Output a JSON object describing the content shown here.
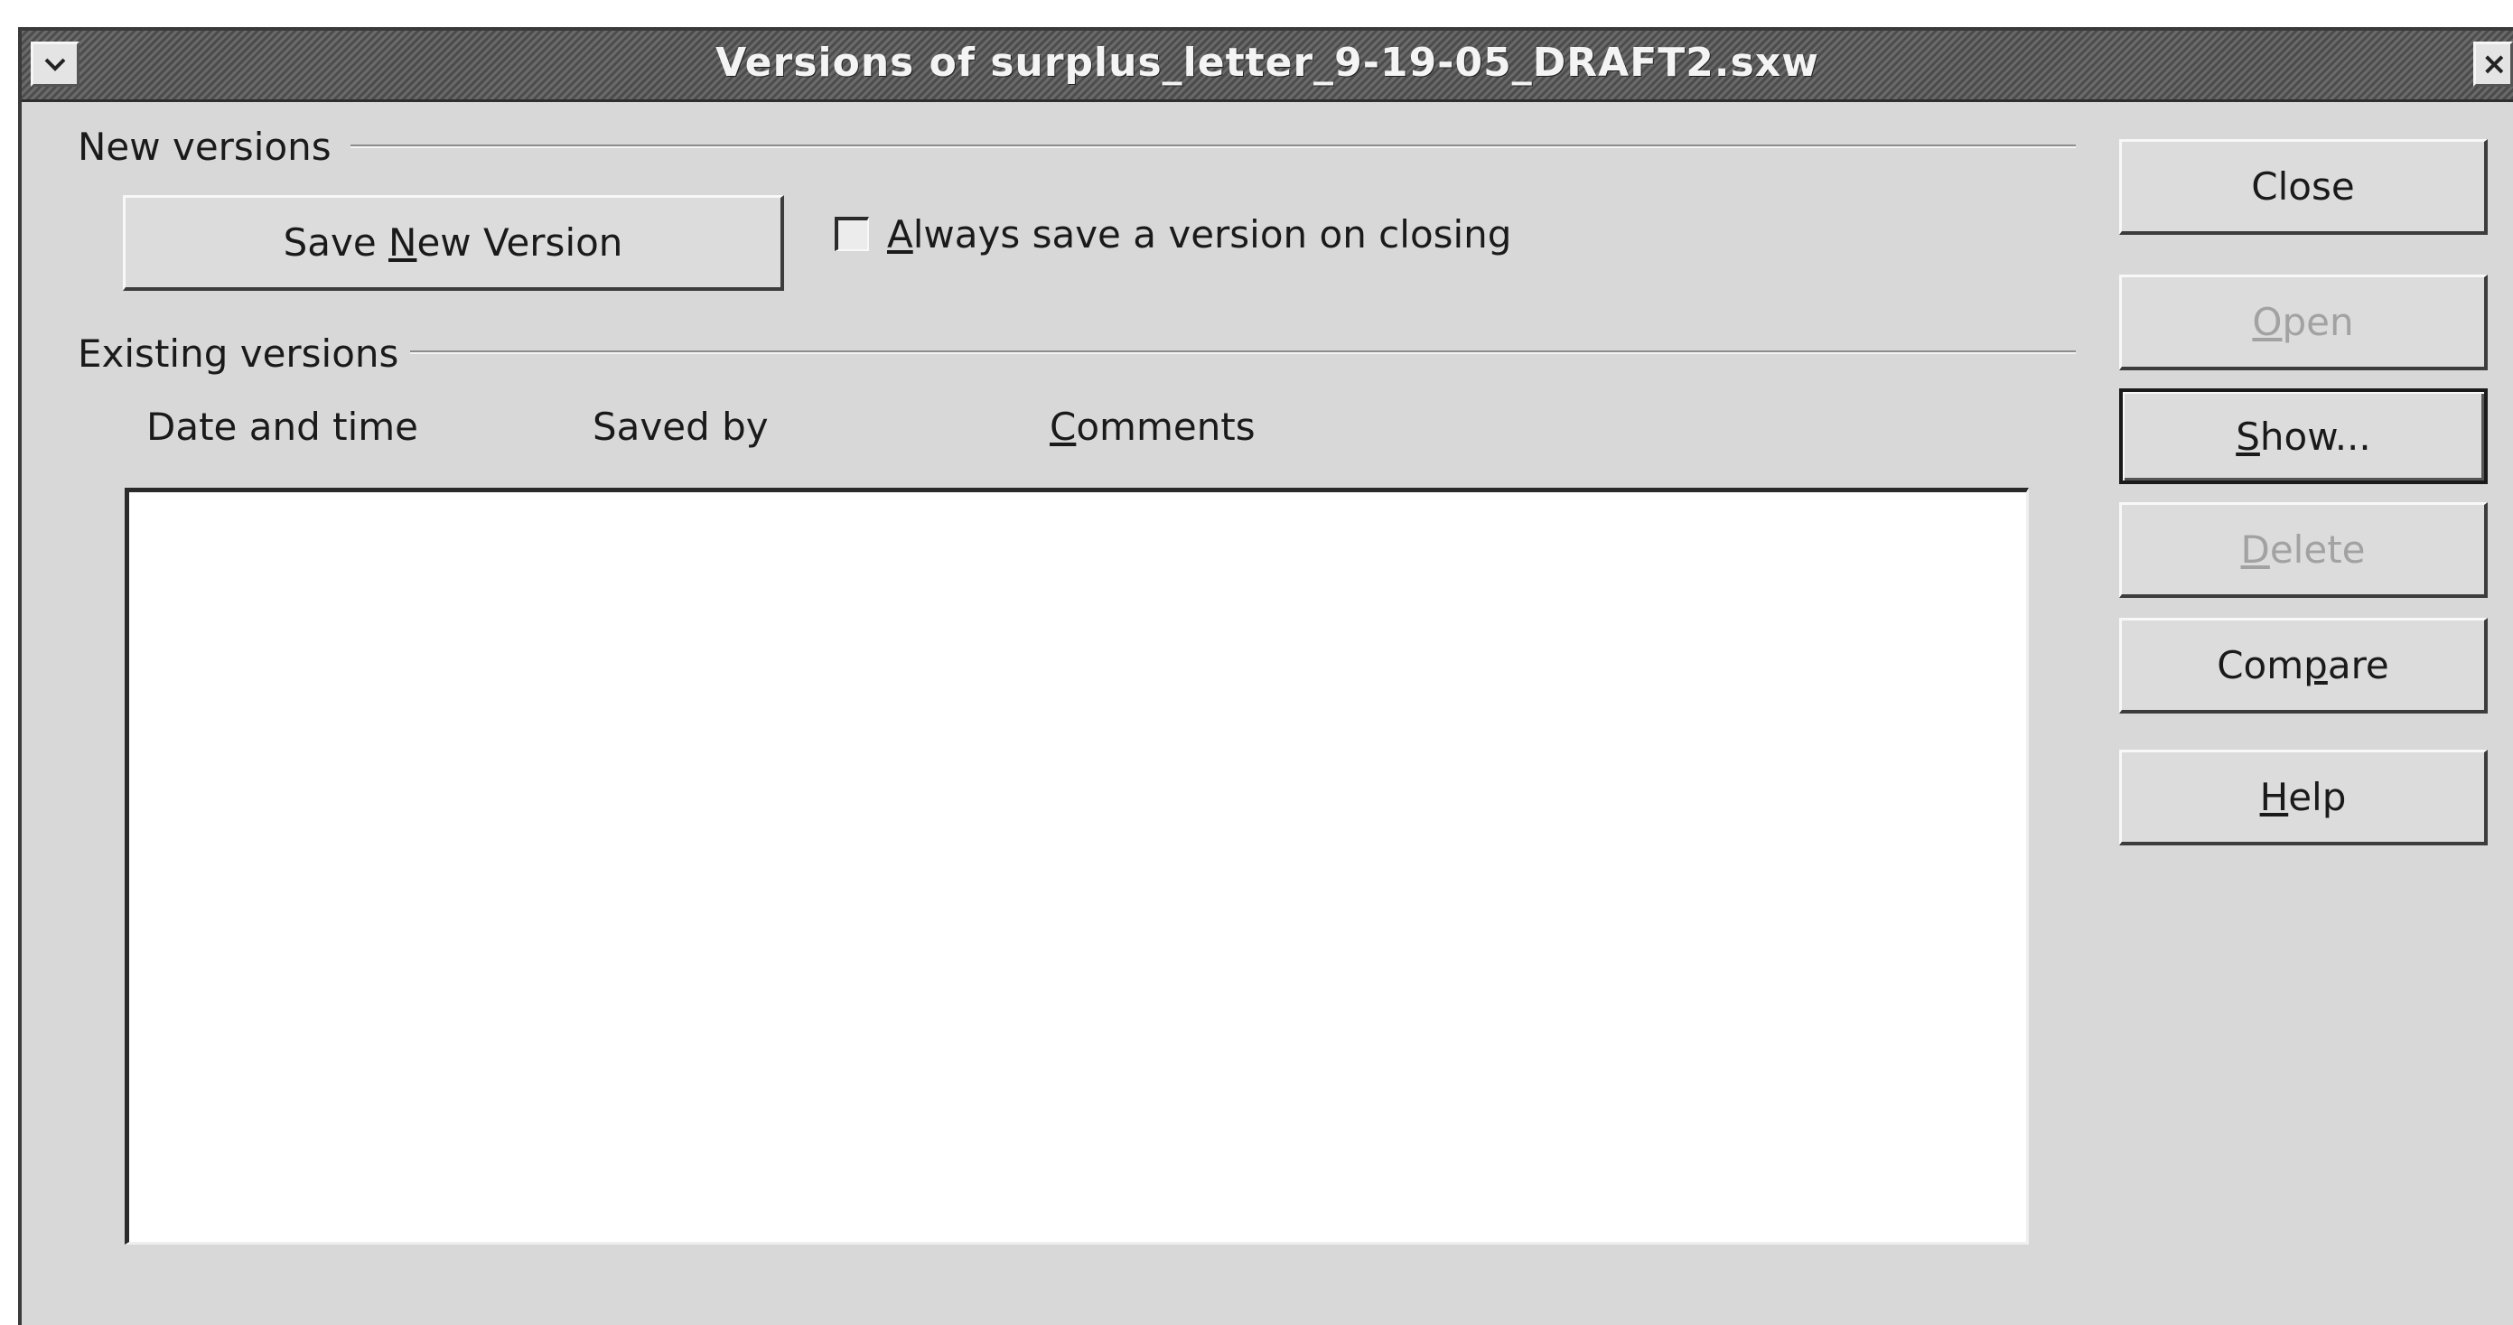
{
  "window": {
    "title": "Versions of surplus_letter_9-19-05_DRAFT2.sxw",
    "menu_icon": "chevron-down-icon",
    "close_icon": "close-icon",
    "close_glyph": "×"
  },
  "new_versions": {
    "group_label": "New versions",
    "save_button": {
      "prefix": "Save ",
      "mnemonic": "N",
      "suffix": "ew Version"
    },
    "always_save": {
      "checked": false,
      "mnemonic": "A",
      "rest": "lways save a version on closing"
    }
  },
  "existing_versions": {
    "group_label": "Existing versions",
    "columns": {
      "date": "Date and time",
      "saved_by": "Saved by",
      "comments_mnemonic": "C",
      "comments_rest": "omments"
    },
    "rows": []
  },
  "buttons": {
    "close": {
      "label": "Close"
    },
    "open": {
      "mnemonic": "O",
      "rest": "pen",
      "disabled": true
    },
    "show": {
      "mnemonic": "S",
      "rest": "how...",
      "default": true
    },
    "delete": {
      "mnemonic": "D",
      "rest": "elete",
      "disabled": true
    },
    "compare": {
      "prefix": "Com",
      "mnemonic": "p",
      "rest": "are"
    },
    "help": {
      "mnemonic": "H",
      "rest": "elp"
    }
  }
}
